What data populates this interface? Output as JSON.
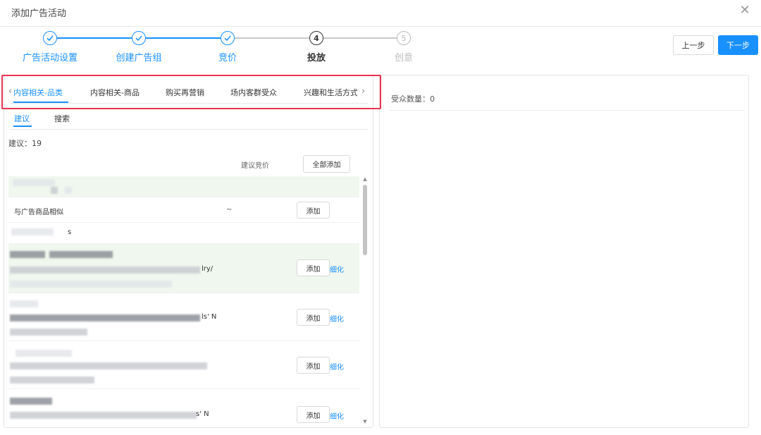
{
  "dialog": {
    "title": "添加广告活动",
    "close_icon": "close-icon"
  },
  "steps": [
    {
      "label": "广告活动设置",
      "state": "done"
    },
    {
      "label": "创建广告组",
      "state": "done"
    },
    {
      "label": "竞价",
      "state": "done"
    },
    {
      "label": "投放",
      "state": "current",
      "number": "4"
    },
    {
      "label": "创意",
      "state": "todo",
      "number": "5"
    }
  ],
  "buttons": {
    "prev": "上一步",
    "next": "下一步"
  },
  "category_tabs": [
    "内容相关-品类",
    "内容相关-商品",
    "购买再营销",
    "场内客群受众",
    "兴趣和生活方式"
  ],
  "sub_tabs": [
    "建议",
    "搜索"
  ],
  "suggest_count": "建议：19",
  "table": {
    "bid_header": "建议竞价",
    "add_all": "全部添加"
  },
  "rows": [
    {
      "text": "与广告商品相似",
      "bid": "~",
      "add": "添加"
    },
    {
      "text": "s",
      "add": ""
    },
    {
      "text": "lry/",
      "add": "添加",
      "refine": "细化"
    },
    {
      "text": "ls' N",
      "add": "添加",
      "refine": "细化"
    },
    {
      "text": "",
      "add": "添加",
      "refine": "细化"
    },
    {
      "text": "s' N",
      "add": "添加",
      "refine": "细化"
    }
  ],
  "audience": {
    "count_label": "受众数量：0"
  },
  "colors": {
    "primary": "#1890ff",
    "highlight": "#e8344f",
    "row_green": "#f0f7ee"
  }
}
